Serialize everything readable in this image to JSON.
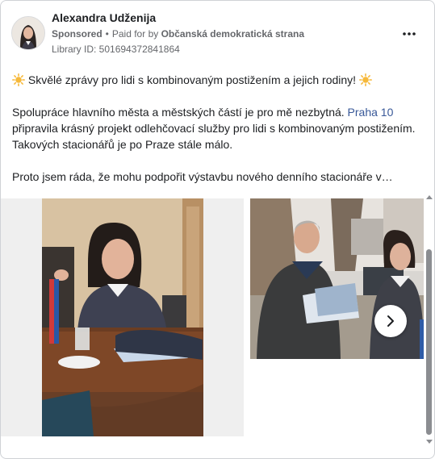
{
  "header": {
    "page_name": "Alexandra Udženija",
    "sponsored_label": "Sponsored",
    "separator": "•",
    "paid_for_prefix": "Paid for by",
    "paid_for_name": "Občanská demokratická strana",
    "library_id": "Library ID: 501694372841864"
  },
  "post": {
    "headline": "Skvělé zprávy pro lidi s kombinovaným postižením a jejich rodiny!",
    "p2_before_link": "Spolupráce hlavního města a městských částí je pro mě nezbytná.",
    "p2_link": "Praha 10",
    "p2_after_link": "připravila krásný projekt odlehčovací služby pro lidi s kombinovaným postižením. Takových stacionářů je po Praze stále málo.",
    "p3": "Proto jsem ráda, že mohu podpořit výstavbu nového denního stacionáře v…"
  },
  "icons": {
    "more": "more-dots-icon",
    "sun": "sun-emoji-icon",
    "next": "chevron-right-icon"
  },
  "colors": {
    "link": "#385898",
    "secondary_text": "#65676b",
    "sun": "#f6b93b"
  }
}
